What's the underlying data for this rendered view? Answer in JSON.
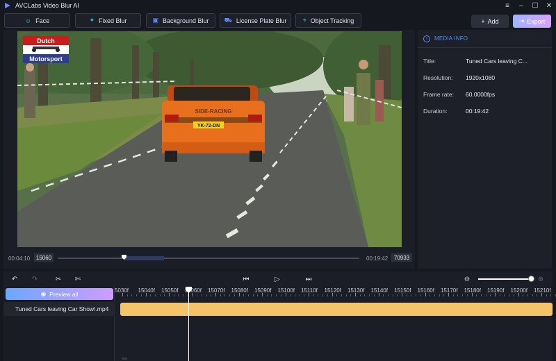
{
  "app": {
    "title": "AVCLabs Video Blur AI"
  },
  "window_controls": [
    "menu-icon",
    "minimize-icon",
    "maximize-icon",
    "close-icon"
  ],
  "toolbar": {
    "buttons": [
      {
        "label": "Face",
        "icon": "face-icon"
      },
      {
        "label": "Fixed Blur",
        "icon": "sparkle-icon"
      },
      {
        "label": "Background Blur",
        "icon": "image-icon"
      },
      {
        "label": "License Plate Blur",
        "icon": "car-icon"
      },
      {
        "label": "Object Tracking",
        "icon": "target-icon"
      }
    ],
    "add_label": "Add",
    "export_label": "Export"
  },
  "player": {
    "current_time": "00:04:10",
    "current_frame": "15060",
    "end_time": "00:19:42",
    "total_frames": "70933",
    "watermark_line1": "Dutch",
    "watermark_line2": "Motorsport",
    "plate_text": "YK-72-DN",
    "car_decal": "SIDE-RACING"
  },
  "media_info": {
    "header": "MEDIA INFO",
    "rows": [
      {
        "key": "Title:",
        "value": "Tuned Cars leaving C..."
      },
      {
        "key": "Resolution:",
        "value": "1920x1080"
      },
      {
        "key": "Frame rate:",
        "value": "60.0000fps"
      },
      {
        "key": "Duration:",
        "value": "00:19:42"
      }
    ]
  },
  "timeline": {
    "preview_label": "Preview all",
    "track_name": "Tuned Cars leaving Car Show!.mp4",
    "ruler_labels": [
      "5030f",
      "15040f",
      "15050f",
      "15060f",
      "15070f",
      "15080f",
      "15090f",
      "15100f",
      "15110f",
      "15120f",
      "15130f",
      "15140f",
      "15150f",
      "15160f",
      "15170f",
      "15180f",
      "15190f",
      "15200f",
      "15210f"
    ],
    "tool_icons": [
      "undo-icon",
      "redo-icon",
      "split-icon",
      "cut-icon",
      "prev-frame-icon",
      "play-icon",
      "next-frame-icon",
      "zoom-out-icon",
      "zoom-in-icon"
    ]
  },
  "colors": {
    "accent_blue": "#4f8dff",
    "clip_yellow": "#f5c36a",
    "teal_icon": "#35c2c9",
    "panel_bg": "#1d2029"
  }
}
